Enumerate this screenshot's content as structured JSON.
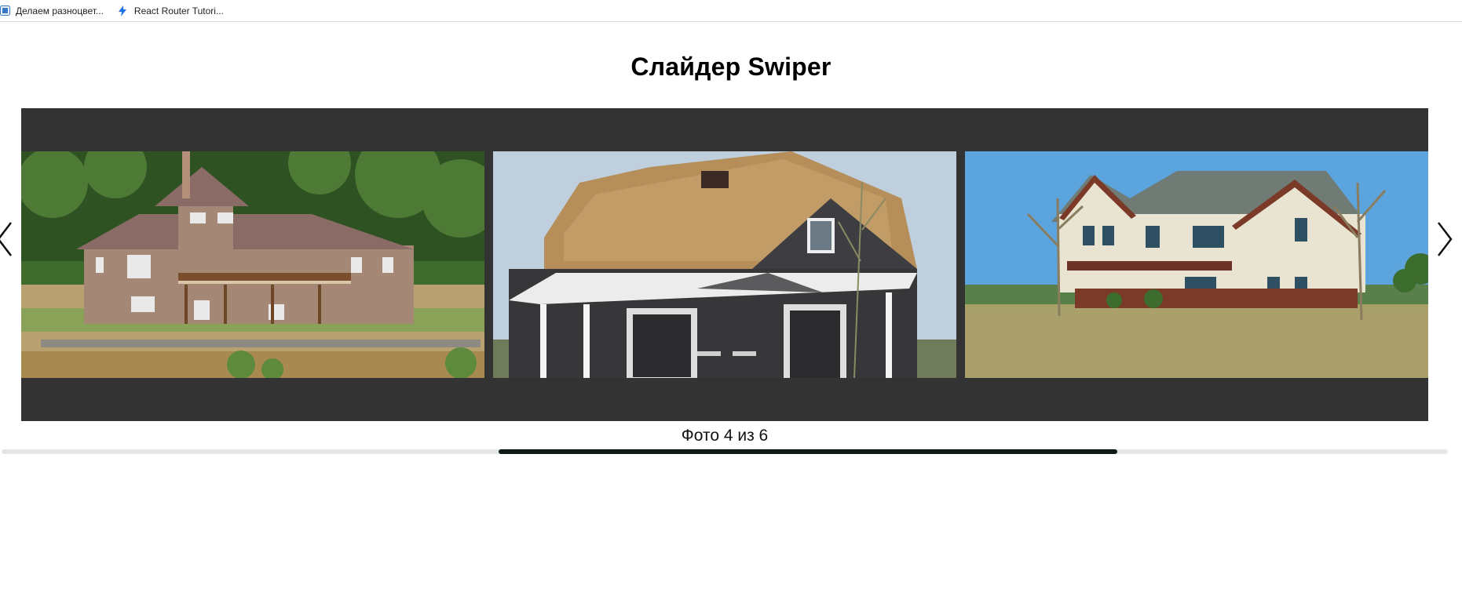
{
  "bookmarks": [
    {
      "label": "Делаем разноцвет...",
      "icon": "page-icon"
    },
    {
      "label": "React Router Tutori...",
      "icon": "bolt-icon"
    }
  ],
  "page": {
    "title": "Слайдер Swiper"
  },
  "slider": {
    "slides": [
      {
        "name": "brick-house-photo"
      },
      {
        "name": "thatched-roof-house-photo"
      },
      {
        "name": "white-siding-house-photo"
      }
    ],
    "counter_text": "Фото 4 из 6",
    "current": 4,
    "total": 6,
    "scroll_position_fraction": 0.35
  },
  "colors": {
    "slider_background": "#333333",
    "scroll_thumb": "#0d1a16",
    "scroll_track": "#e6e6e6"
  }
}
